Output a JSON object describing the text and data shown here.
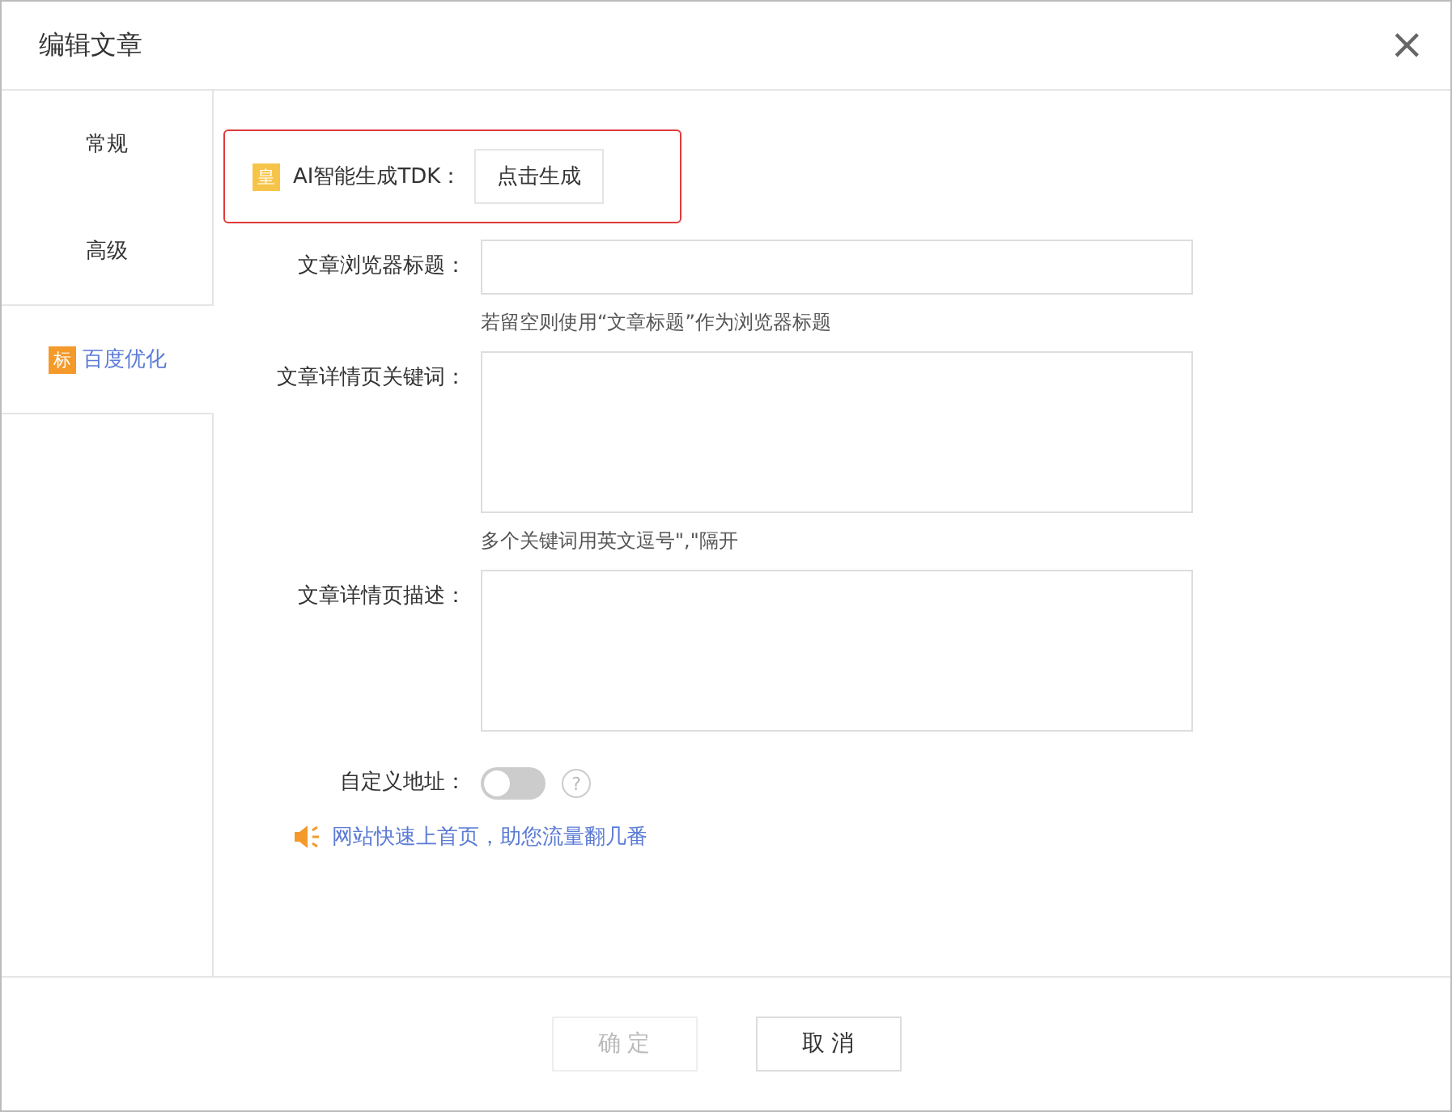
{
  "dialog": {
    "title": "编辑文章",
    "close": "×"
  },
  "tabs": [
    {
      "label": "常规",
      "selected": false
    },
    {
      "label": "高级",
      "selected": false
    },
    {
      "label": "百度优化",
      "selected": true,
      "badge": "标"
    }
  ],
  "ai_row": {
    "badge": "皇",
    "label": "AI智能生成TDK：",
    "button": "点击生成"
  },
  "fields": [
    {
      "kind": "input",
      "label": "文章浏览器标题：",
      "hint": "若留空则使用“文章标题”作为浏览器标题"
    },
    {
      "kind": "textarea",
      "label": "文章详情页关键词：",
      "hint": "多个关键词用英文逗号\",\"隔开"
    },
    {
      "kind": "textarea",
      "label": "文章详情页描述："
    }
  ],
  "custom_url": {
    "label": "自定义地址：",
    "on": false,
    "help": "?"
  },
  "promo": "网站快速上首页，助您流量翻几番",
  "buttons": [
    {
      "label": "确 定",
      "disabled": true
    },
    {
      "label": "取 消",
      "disabled": false
    }
  ]
}
